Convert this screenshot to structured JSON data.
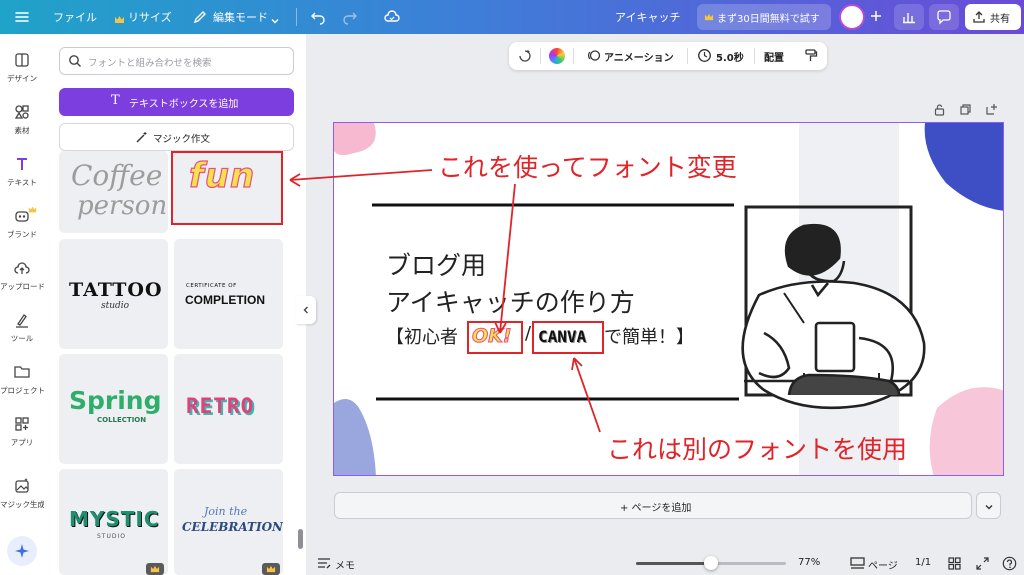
{
  "topbar": {
    "file_label": "ファイル",
    "resize_label": "リサイズ",
    "edit_mode_label": "編集モード",
    "doc_title": "アイキャッチ",
    "trial_label": "まず30日間無料で試す",
    "share_label": "共有"
  },
  "rail": {
    "items": [
      {
        "label": "デザイン"
      },
      {
        "label": "素材"
      },
      {
        "label": "テキスト"
      },
      {
        "label": "ブランド"
      },
      {
        "label": "アップロード"
      },
      {
        "label": "ツール"
      },
      {
        "label": "プロジェクト"
      },
      {
        "label": "アプリ"
      },
      {
        "label": "マジック生成"
      }
    ]
  },
  "panel": {
    "search_placeholder": "フォントと組み合わせを検索",
    "add_textbox_label": "テキストボックスを追加",
    "magic_write_label": "マジック作文",
    "tiles": [
      {
        "line1": "Coffee",
        "line2": "person"
      },
      {
        "line1": "fun"
      },
      {
        "line1": "TATTOO",
        "line2": "studio"
      },
      {
        "line1": "CERTIFICATE OF",
        "line2": "COMPLETION"
      },
      {
        "line1": "Spring",
        "line2": "COLLECTION"
      },
      {
        "line1": "RETRO"
      },
      {
        "line1": "MYSTIC",
        "line2": "STUDIO"
      },
      {
        "line1": "Join the",
        "line2": "CELEBRATION!"
      }
    ]
  },
  "toolbar": {
    "animation_label": "アニメーション",
    "duration_label": "5.0秒",
    "position_label": "配置"
  },
  "design": {
    "heading1": "ブログ用",
    "heading2": "アイキャッチの作り方",
    "sub_prefix": "【初心者",
    "ok_text": "OK!",
    "slash": "/",
    "canva_text": "CANVA",
    "sub_suffix": "で簡単！】"
  },
  "annotations": {
    "top_note": "これを使ってフォント変更",
    "bottom_note": "これは別のフォントを使用"
  },
  "bottom": {
    "add_page_label": "+ ページを追加",
    "memo_label": "メモ",
    "zoom_label": "77%",
    "pages_label": "ページ",
    "page_count": "1/1"
  },
  "colors": {
    "accent_purple": "#7d3ee0",
    "annotation_red": "#e0242a",
    "topbar_start": "#1fa3c9",
    "topbar_end": "#6a4bd8"
  }
}
